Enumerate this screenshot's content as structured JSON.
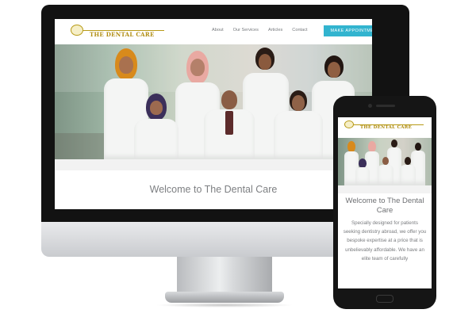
{
  "site": {
    "logo_text": "THE DENTAL CARE",
    "nav": [
      "About",
      "Our Services",
      "Articles",
      "Contact"
    ],
    "cta_label": "MAKE APPOINTMENT",
    "welcome": "Welcome to The Dental Care"
  },
  "mobile": {
    "logo_text": "THE DENTAL CARE",
    "welcome": "Welcome to The Dental Care",
    "intro": "Specially designed for patients seeking dentistry abroad, we offer you bespoke expertise at a price that is unbelievably affordable. We have an elite team of carefully"
  },
  "colors": {
    "brand_gold": "#b08d12",
    "cta": "#32b4cf",
    "text_gray": "#7d7f82"
  },
  "icons": {
    "logo": "tooth-logo-icon"
  }
}
